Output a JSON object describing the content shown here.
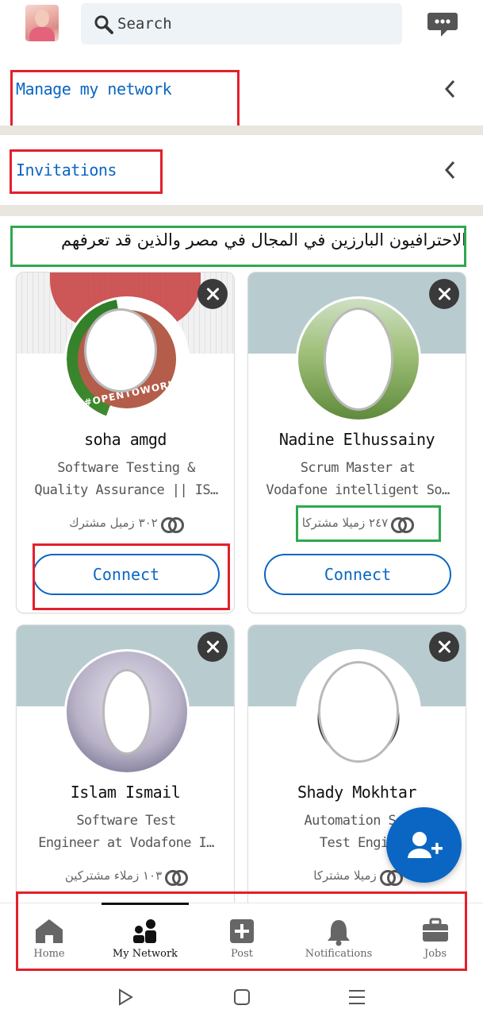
{
  "search": {
    "placeholder": "Search"
  },
  "rows": {
    "manage": "Manage my network",
    "invitations": "Invitations"
  },
  "section_title": "الاحترافيون البارزين في المجال في مصر والذين قد تعرفهم",
  "cards": [
    {
      "name": "soha amgd",
      "title_line1": "Software Testing &",
      "title_line2": "Quality Assurance || IS…",
      "mutual": "٣٠٢ زميل مشترك",
      "button": "Connect",
      "badge": "#OPENTOWORK"
    },
    {
      "name": "Nadine Elhussainy",
      "title_line1": "Scrum Master at",
      "title_line2": "Vodafone intelligent So…",
      "mutual": "٢٤٧ زميلا مشتركا",
      "button": "Connect"
    },
    {
      "name": "Islam Ismail",
      "title_line1": "Software Test",
      "title_line2": "Engineer at Vodafone I…",
      "mutual": "١٠٣ زملاء مشتركين"
    },
    {
      "name": "Shady Mokhtar",
      "title_line1": "Automation Sof",
      "title_line2": "Test Engin",
      "mutual": "زميلا مشتركا"
    }
  ],
  "nav": [
    {
      "label": "Home",
      "icon": "home-icon"
    },
    {
      "label": "My Network",
      "icon": "my-network-icon",
      "active": true
    },
    {
      "label": "Post",
      "icon": "post-icon"
    },
    {
      "label": "Notifications",
      "icon": "bell-icon"
    },
    {
      "label": "Jobs",
      "icon": "briefcase-icon"
    }
  ],
  "colors": {
    "accent": "#0a66c2",
    "highlight_red": "#e3202b",
    "highlight_green": "#2fa84f"
  }
}
